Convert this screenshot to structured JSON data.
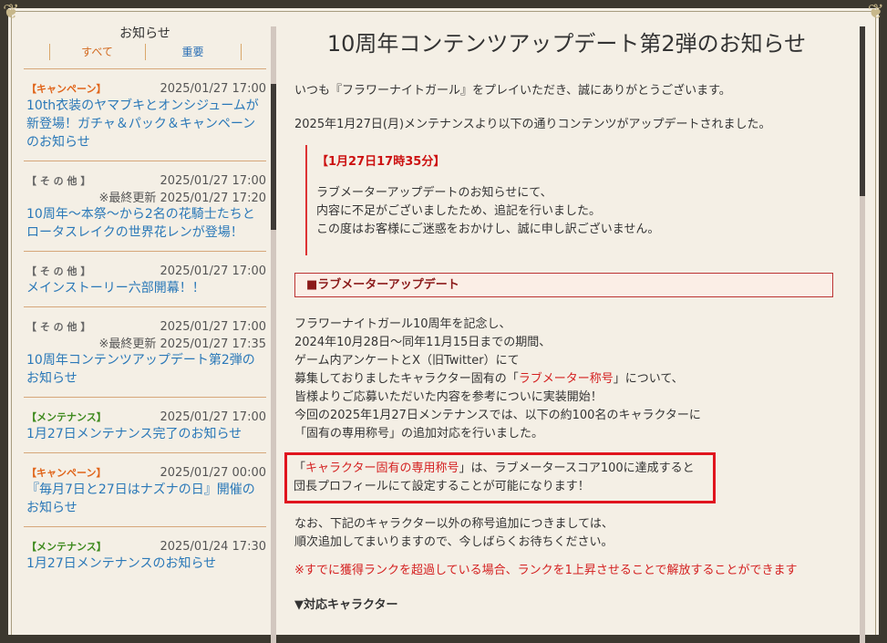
{
  "sidebar": {
    "title": "お知らせ",
    "tabs": [
      {
        "label": "すべて"
      },
      {
        "label": "重要"
      }
    ],
    "items": [
      {
        "category": "【キャンペーン】",
        "date": "2025/01/27 17:00",
        "updated": "",
        "title": "10th衣装のヤマブキとオンシジュームが新登場！ガチャ＆パック＆キャンペーンのお知らせ"
      },
      {
        "category": "【 そ の 他 】",
        "date": "2025/01/27 17:00",
        "updated": "※最終更新 2025/01/27 17:20",
        "title": "10周年～本祭～から2名の花騎士たちとロータスレイクの世界花レンが登場！"
      },
      {
        "category": "【 そ の 他 】",
        "date": "2025/01/27 17:00",
        "updated": "",
        "title": "メインストーリー六部開幕！！"
      },
      {
        "category": "【 そ の 他 】",
        "date": "2025/01/27 17:00",
        "updated": "※最終更新 2025/01/27 17:35",
        "title": "10周年コンテンツアップデート第2弾のお知らせ"
      },
      {
        "category": "【メンテナンス】",
        "date": "2025/01/27 17:00",
        "updated": "",
        "title": "1月27日メンテナンス完了のお知らせ"
      },
      {
        "category": "【キャンペーン】",
        "date": "2025/01/27 00:00",
        "updated": "",
        "title": "『毎月7日と27日はナズナの日』開催のお知らせ"
      },
      {
        "category": "【メンテナンス】",
        "date": "2025/01/24 17:30",
        "updated": "",
        "title": "1月27日メンテナンスのお知らせ"
      }
    ]
  },
  "main": {
    "title": "10周年コンテンツアップデート第2弾のお知らせ",
    "intro1": "いつも『フラワーナイトガール』をプレイいただき、誠にありがとうございます。",
    "intro2": "2025年1月27日(月)メンテナンスより以下の通りコンテンツがアップデートされました。",
    "notice": {
      "head": "【1月27日17時35分】",
      "lines": [
        "ラブメーターアップデートのお知らせにて、",
        "内容に不足がございましたため、追記を行いました。",
        "この度はお客様にご迷惑をおかけし、誠に申し訳ございません。"
      ]
    },
    "section_head": "■ラブメーターアップデート",
    "body": [
      "フラワーナイトガール10周年を記念し、",
      "2024年10月28日～同年11月15日までの期間、",
      "ゲーム内アンケートとX（旧Twitter）にて"
    ],
    "body4_pre": "募集しておりましたキャラクター固有の「",
    "body4_red": "ラブメーター称号",
    "body4_post": "」について、",
    "body_rest": [
      "皆様よりご応募いただいた内容を参考についに実装開始！",
      "今回の2025年1月27日メンテナンスでは、以下の約100名のキャラクターに",
      "「固有の専用称号」の追加対応を行いました。"
    ],
    "hl_pre": "「",
    "hl_red": "キャラクター固有の専用称号",
    "hl_post": "」は、ラブメータースコア100に達成すると",
    "hl_line2": "団長プロフィールにて設定することが可能になります！",
    "after": [
      "なお、下記のキャラクター以外の称号追加につきましては、",
      "順次追加してまいりますので、今しばらくお待ちください。"
    ],
    "red_note": "※すでに獲得ランクを超過している場合、ランクを1上昇させることで解放することができます",
    "target_head": "▼対応キャラクター"
  }
}
